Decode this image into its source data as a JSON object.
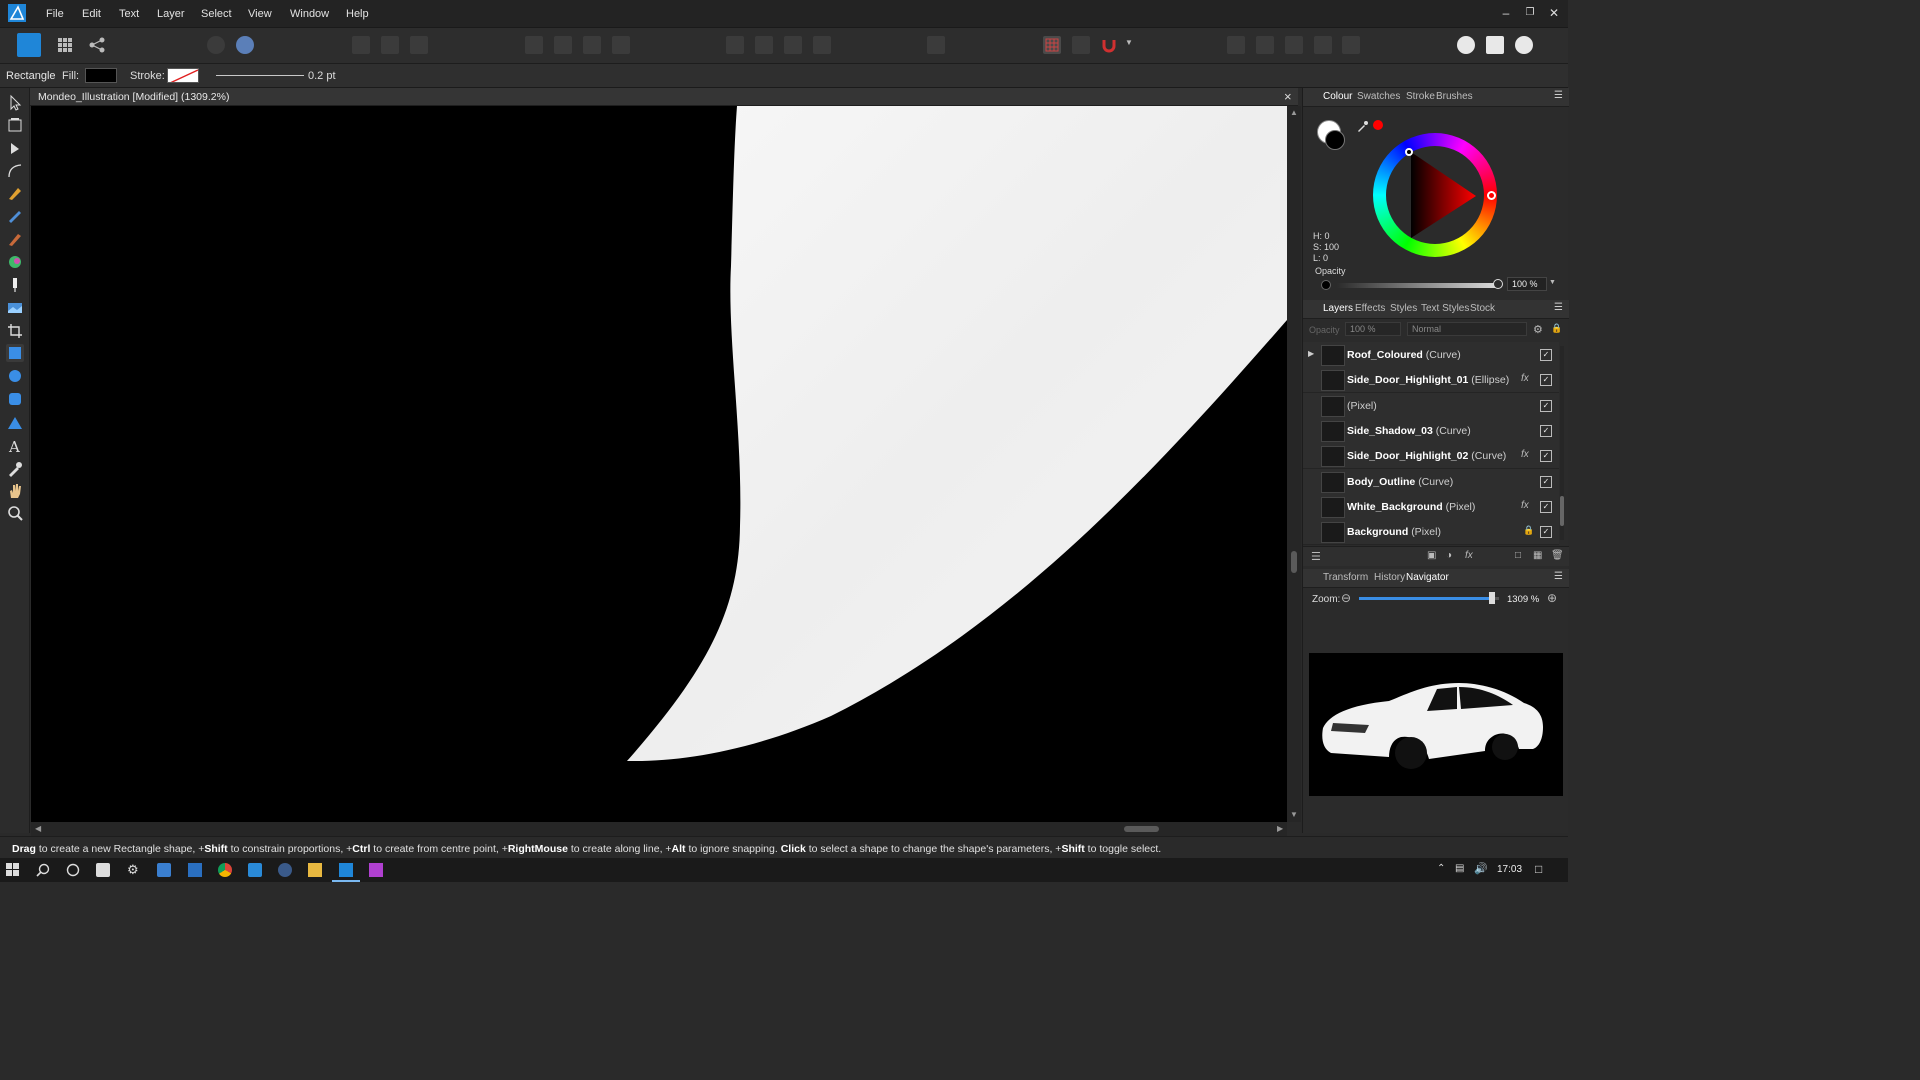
{
  "menu": {
    "items": [
      "File",
      "Edit",
      "Text",
      "Layer",
      "Select",
      "View",
      "Window",
      "Help"
    ]
  },
  "context": {
    "tool": "Rectangle",
    "fill_label": "Fill:",
    "stroke_label": "Stroke:",
    "stroke_width": "0.2 pt"
  },
  "document": {
    "title": "Mondeo_Illustration [Modified] (1309.2%)"
  },
  "colour_panel": {
    "tabs": [
      "Colour",
      "Swatches",
      "Stroke",
      "Brushes"
    ],
    "h": "H: 0",
    "s": "S: 100",
    "l": "L: 0",
    "opacity_label": "Opacity",
    "opacity_value": "100 %",
    "opacity": 1.0
  },
  "layers_panel": {
    "tabs": [
      "Layers",
      "Effects",
      "Styles",
      "Text Styles",
      "Stock"
    ],
    "opacity_label": "Opacity",
    "opacity_value": "100 %",
    "blend_mode": "Normal",
    "rows": [
      {
        "name": "Roof_Coloured",
        "type": "(Curve)",
        "fx": false,
        "locked": false,
        "expandable": true
      },
      {
        "name": "Side_Door_Highlight_01",
        "type": "(Ellipse)",
        "fx": true,
        "locked": false
      },
      {
        "name": "",
        "type": "(Pixel)",
        "fx": false,
        "locked": false
      },
      {
        "name": "Side_Shadow_03",
        "type": "(Curve)",
        "fx": false,
        "locked": false
      },
      {
        "name": "Side_Door_Highlight_02",
        "type": "(Curve)",
        "fx": true,
        "locked": false
      },
      {
        "name": "Body_Outline",
        "type": "(Curve)",
        "fx": false,
        "locked": false
      },
      {
        "name": "White_Background",
        "type": "(Pixel)",
        "fx": true,
        "locked": false
      },
      {
        "name": "Background",
        "type": "(Pixel)",
        "fx": false,
        "locked": true
      }
    ]
  },
  "bottom_panel": {
    "tabs": [
      "Transform",
      "History",
      "Navigator"
    ],
    "zoom_label": "Zoom:",
    "zoom_value": "1309 %",
    "zoom": 0.95
  },
  "status": {
    "segments": [
      {
        "bold": true,
        "text": "Drag"
      },
      {
        "bold": false,
        "text": " to create a new Rectangle shape, +"
      },
      {
        "bold": true,
        "text": "Shift"
      },
      {
        "bold": false,
        "text": " to constrain proportions, +"
      },
      {
        "bold": true,
        "text": "Ctrl"
      },
      {
        "bold": false,
        "text": " to create from centre point, +"
      },
      {
        "bold": true,
        "text": "RightMouse"
      },
      {
        "bold": false,
        "text": " to create along line, +"
      },
      {
        "bold": true,
        "text": "Alt"
      },
      {
        "bold": false,
        "text": " to ignore snapping. "
      },
      {
        "bold": true,
        "text": "Click"
      },
      {
        "bold": false,
        "text": " to select a shape to change the shape's parameters, +"
      },
      {
        "bold": true,
        "text": "Shift"
      },
      {
        "bold": false,
        "text": " to toggle select."
      }
    ]
  },
  "taskbar": {
    "time": "17:03"
  },
  "colors": {
    "accent": "#1f86d8",
    "canvas": "#000000",
    "shape": "#f4f4f4",
    "picker_red": "#ff0000"
  }
}
